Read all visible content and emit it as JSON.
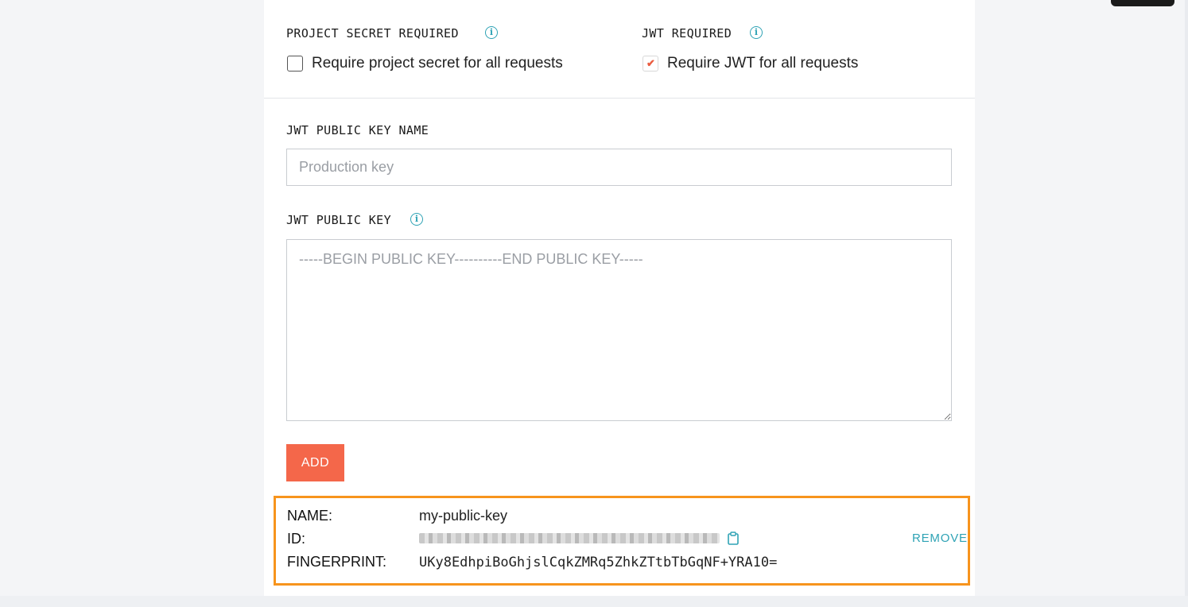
{
  "settings": {
    "project_secret": {
      "label": "PROJECT SECRET REQUIRED",
      "checkbox_label": "Require project secret for all requests",
      "checked": false
    },
    "jwt_required": {
      "label": "JWT REQUIRED",
      "checkbox_label": "Require JWT for all requests",
      "checked": true
    }
  },
  "form": {
    "key_name_label": "JWT PUBLIC KEY NAME",
    "key_name_placeholder": "Production key",
    "public_key_label": "JWT PUBLIC KEY",
    "public_key_placeholder": "-----BEGIN PUBLIC KEY----------END PUBLIC KEY-----",
    "add_label": "ADD"
  },
  "key_entry": {
    "name_label": "NAME:",
    "name_value": "my-public-key",
    "id_label": "ID:",
    "fingerprint_label": "FINGERPRINT:",
    "fingerprint_value": "UKy8EdhpiBoGhjslCqkZMRq5ZhkZTtbTbGqNF+YRA10=",
    "remove_label": "REMOVE"
  },
  "icons": {
    "info": "info-icon",
    "checkmark": "checkmark-icon",
    "clipboard": "clipboard-icon"
  },
  "colors": {
    "accent": "#f4674a",
    "link": "#2fa3b5",
    "highlight_border": "#f7941d"
  }
}
